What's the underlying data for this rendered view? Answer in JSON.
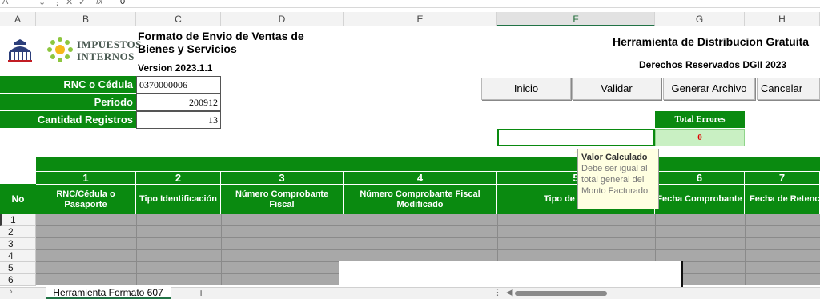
{
  "formula_bar": {
    "cell_ref": "A",
    "x_icon": "✕",
    "check_icon": "✓",
    "fx_label": "fx",
    "value": "0"
  },
  "columns": [
    "A",
    "B",
    "C",
    "D",
    "E",
    "F",
    "G",
    "H"
  ],
  "selected_column": "F",
  "logos": {
    "shield": "gob-shield-icon",
    "impuestos_line1": "IMPUESTOS",
    "impuestos_line2": "INTERNOS"
  },
  "header": {
    "title": "Formato de Envio de Ventas de Bienes y Servicios",
    "version": "Version 2023.1.1",
    "tool_title": "Herramienta de Distribucion Gratuita",
    "rights": "Derechos Reservados DGII 2023"
  },
  "info": [
    {
      "label": "RNC o Cédula",
      "value": "0370000006"
    },
    {
      "label": "Periodo",
      "value": "200912"
    },
    {
      "label": "Cantidad Registros",
      "value": "13"
    }
  ],
  "buttons": {
    "inicio": "Inicio",
    "validar": "Validar",
    "generar": "Generar Archivo",
    "cancelar": "Cancelar"
  },
  "errors": {
    "header": "Total Errores",
    "value": "0"
  },
  "tooltip": {
    "title": "Valor Calculado",
    "body": "Debe ser igual al total general del Monto Facturado."
  },
  "grid": {
    "no_header": "No",
    "col_numbers": [
      "1",
      "2",
      "3",
      "4",
      "5",
      "6",
      "7"
    ],
    "col_headers": [
      "RNC/Cédula o Pasaporte",
      "Tipo Identificación",
      "Número Comprobante Fiscal",
      "Número Comprobante Fiscal Modificado",
      "Tipo de",
      "Fecha Comprobante",
      "Fecha de Retencio"
    ],
    "row_numbers": [
      "1",
      "2",
      "3",
      "4",
      "5",
      "6"
    ]
  },
  "sheet_tabs": {
    "active": "Herramienta Formato 607",
    "add": "+"
  },
  "colors": {
    "green": "#0a8a10",
    "error_red": "#e00000",
    "excel_green": "#217346"
  }
}
